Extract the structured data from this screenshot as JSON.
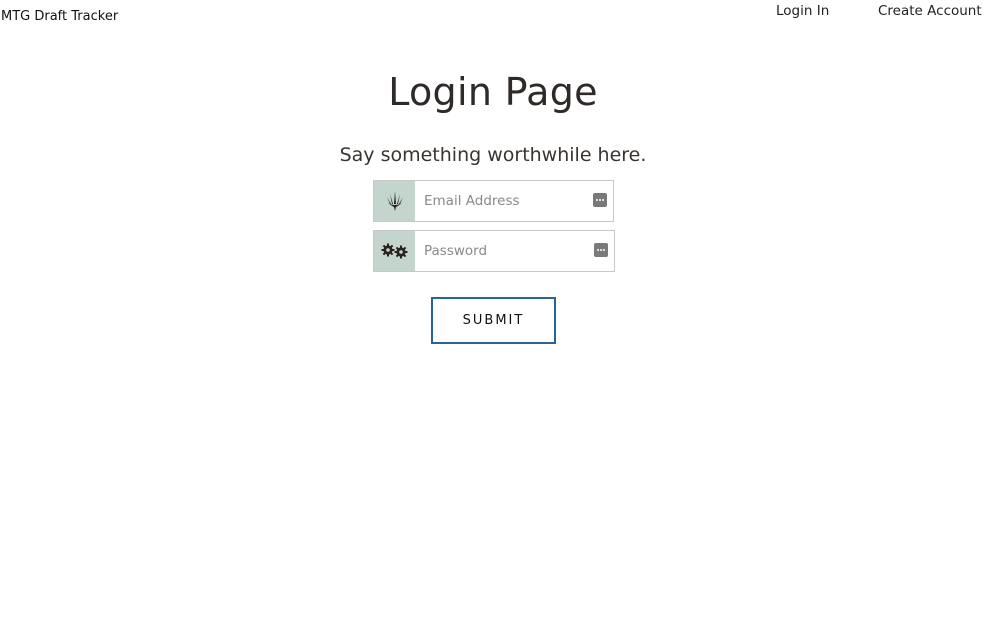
{
  "header": {
    "brand": "MTG Draft Tracker",
    "nav": {
      "login": "Login In",
      "create_account": "Create Account"
    }
  },
  "main": {
    "title": "Login Page",
    "subtitle": "Say something worthwhile here.",
    "email_field": {
      "placeholder": "Email Address",
      "value": "",
      "addon_icon": "planeswalker-icon",
      "fill_icon": "autofill-icon"
    },
    "password_field": {
      "placeholder": "Password",
      "value": "",
      "addon_icon": "gears-icon",
      "fill_icon": "autofill-icon"
    },
    "submit_label": "SUBMIT"
  },
  "colors": {
    "addon_bg": "#c3d5cc",
    "submit_border": "#2a6496",
    "text": "#2f2a27"
  }
}
